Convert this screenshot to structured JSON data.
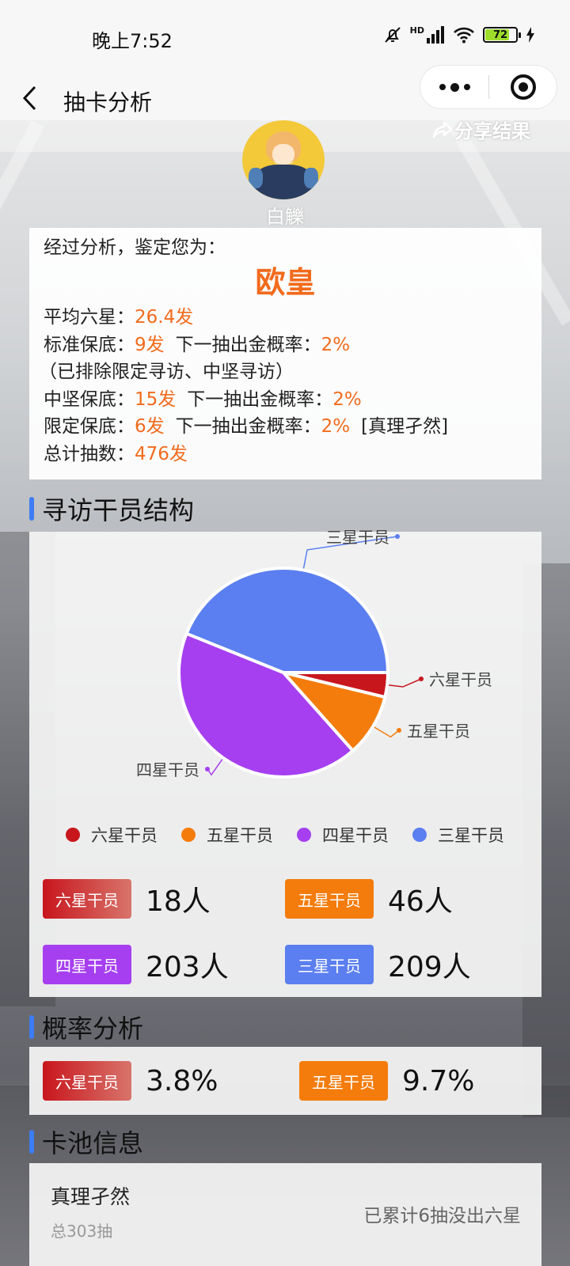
{
  "status_bar": {
    "time": "晚上7:52",
    "network": "HD",
    "battery": "72",
    "icons": [
      "mute-bell-icon",
      "signal-icon",
      "wifi-icon",
      "battery-icon",
      "charging-icon"
    ]
  },
  "nav": {
    "title": "抽卡分析",
    "back_icon": "chevron-left-icon",
    "more_icon": "more-dots-icon",
    "close_icon": "target-close-icon"
  },
  "share_label": "分享结果",
  "user": {
    "name": "白觻"
  },
  "result": {
    "intro": "经过分析，鉴定您为：",
    "verdict": "欧皇",
    "avg_label": "平均六星：",
    "avg_value": "26.4发",
    "standard_label": "标准保底：",
    "standard_value": "9发",
    "standard_next_label": "下一抽出金概率：",
    "standard_next_value": "2%",
    "exclusion_note": "（已排除限定寻访、中坚寻访）",
    "core_label": "中坚保底：",
    "core_value": "15发",
    "core_next_label": "下一抽出金概率：",
    "core_next_value": "2%",
    "limited_label": "限定保底：",
    "limited_value": "6发",
    "limited_next_label": "下一抽出金概率：",
    "limited_next_value": "2%",
    "limited_pool": "[真理孑然]",
    "total_label": "总计抽数：",
    "total_value": "476发"
  },
  "sections": {
    "structure": "寻访干员结构",
    "probability": "概率分析",
    "pool": "卡池信息"
  },
  "chart_data": {
    "type": "pie",
    "categories": [
      "六星干员",
      "五星干员",
      "四星干员",
      "三星干员"
    ],
    "values": [
      18,
      46,
      203,
      209
    ],
    "colors": [
      "#c8161d",
      "#f47c0c",
      "#a63ff0",
      "#5b7ff0"
    ],
    "legend_position": "bottom"
  },
  "counts": [
    {
      "label": "六星干员",
      "value": "18人"
    },
    {
      "label": "五星干员",
      "value": "46人"
    },
    {
      "label": "四星干员",
      "value": "203人"
    },
    {
      "label": "三星干员",
      "value": "209人"
    }
  ],
  "probability": [
    {
      "label": "六星干员",
      "value": "3.8%"
    },
    {
      "label": "五星干员",
      "value": "9.7%"
    }
  ],
  "pool": {
    "name": "真理孑然",
    "total": "总303抽",
    "note": "已累计6抽没出六星"
  }
}
